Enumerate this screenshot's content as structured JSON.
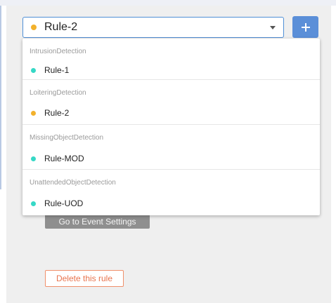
{
  "rule_select": {
    "value": "Rule-2",
    "dot_color": "#f2b12c",
    "caret_icon": "chevron-down-icon"
  },
  "add_button": {
    "icon": "plus-icon",
    "color": "#5b8fd8"
  },
  "dropdown": {
    "groups": [
      {
        "label": "IntrusionDetection",
        "option": "Rule-1",
        "dot_color": "#36d8c6"
      },
      {
        "label": "LoiteringDetection",
        "option": "Rule-2",
        "dot_color": "#f2b12c"
      },
      {
        "label": "MissingObjectDetection",
        "option": "Rule-MOD",
        "dot_color": "#36d8c6"
      },
      {
        "label": "UnattendedObjectDetection",
        "option": "Rule-UOD",
        "dot_color": "#36d8c6"
      }
    ]
  },
  "actions": {
    "event_settings_label": "Go to Event Settings",
    "delete_rule_label": "Delete this rule",
    "delete_color": "#e8744e"
  }
}
